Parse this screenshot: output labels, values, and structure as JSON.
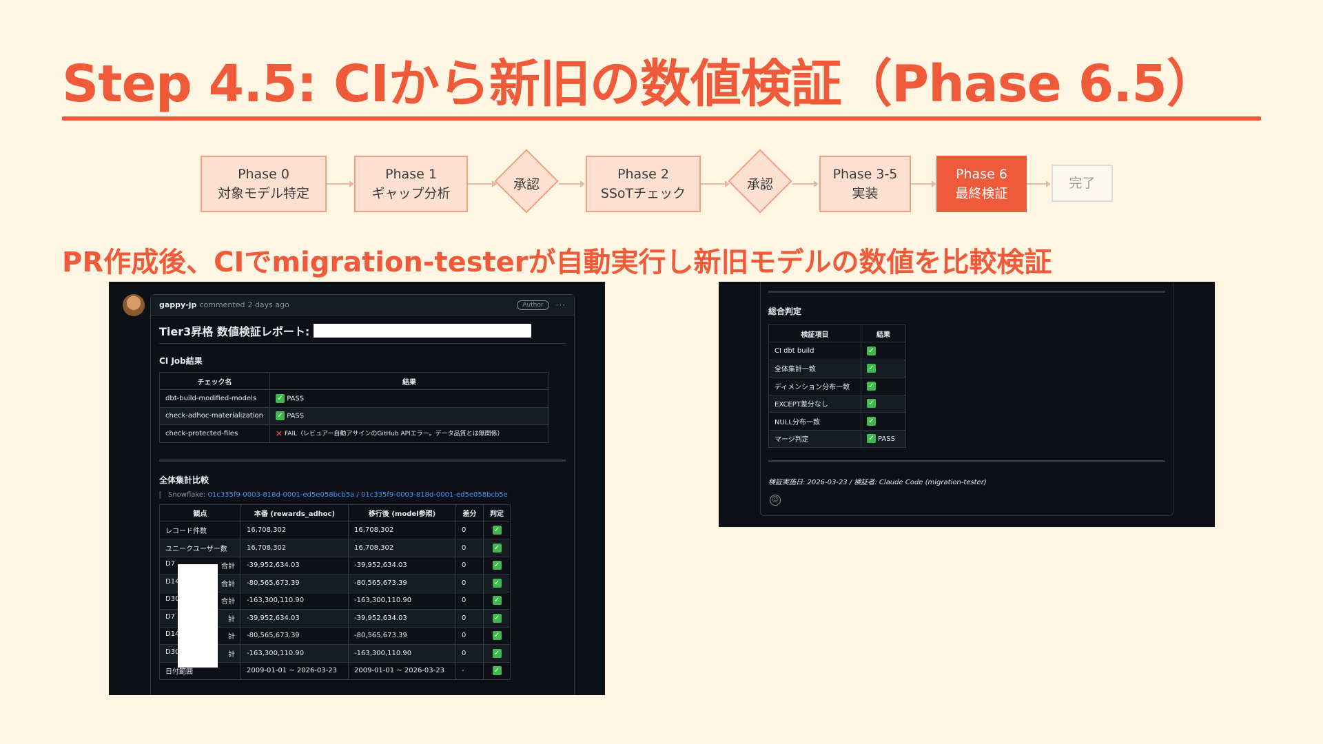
{
  "slide": {
    "title": "Step 4.5: CIから新旧の数値検証（Phase 6.5）",
    "subtitle": "PR作成後、CIでmigration-testerが自動実行し新旧モデルの数値を比較検証"
  },
  "flow": {
    "phase0": {
      "title": "Phase 0",
      "sub": "対象モデル特定"
    },
    "phase1": {
      "title": "Phase 1",
      "sub": "ギャップ分析"
    },
    "approve1": "承認",
    "phase2": {
      "title": "Phase 2",
      "sub": "SSoTチェック"
    },
    "approve2": "承認",
    "phase35": {
      "title": "Phase 3-5",
      "sub": "実装"
    },
    "phase6": {
      "title": "Phase 6",
      "sub": "最終検証"
    },
    "done": "完了"
  },
  "comment": {
    "user": "gappy-jp",
    "action": "commented",
    "time": "2 days ago",
    "badge": "Author",
    "more": "···",
    "report_title": "Tier3昇格 数値検証レポート:",
    "ci_heading": "CI Job結果",
    "ci_table": {
      "headers": [
        "チェック名",
        "結果"
      ],
      "rows": [
        {
          "name": "dbt-build-modified-models",
          "result": "PASS"
        },
        {
          "name": "check-adhoc-materialization",
          "result": "PASS"
        },
        {
          "name": "check-protected-files",
          "result": "FAIL（レビュアー自動アサインのGitHub APIエラー。データ品質とは無関係）"
        }
      ]
    },
    "agg_heading": "全体集計比較",
    "snowflake_label": "Snowflake:",
    "snowflake_link": "01c335f9-0003-818d-0001-ed5e058bcb5a / 01c335f9-0003-818d-0001-ed5e058bcb5e",
    "agg_table": {
      "headers": [
        "観点",
        "本番 (rewards_adhoc)",
        "移行後 (model参照)",
        "差分",
        "判定"
      ],
      "rows": [
        {
          "label": "レコード件数",
          "prod": "16,708,302",
          "after": "16,708,302",
          "diff": "0"
        },
        {
          "label": "ユニークユーザー数",
          "prod": "16,708,302",
          "after": "16,708,302",
          "diff": "0"
        },
        {
          "label": "D7",
          "tail": "合計",
          "prod": "-39,952,634.03",
          "after": "-39,952,634.03",
          "diff": "0"
        },
        {
          "label": "D14",
          "tail": "合計",
          "prod": "-80,565,673.39",
          "after": "-80,565,673.39",
          "diff": "0"
        },
        {
          "label": "D30",
          "tail": "合計",
          "prod": "-163,300,110.90",
          "after": "-163,300,110.90",
          "diff": "0"
        },
        {
          "label": "D7",
          "tail": "計",
          "prod": "-39,952,634.03",
          "after": "-39,952,634.03",
          "diff": "0"
        },
        {
          "label": "D14",
          "tail": "計",
          "prod": "-80,565,673.39",
          "after": "-80,565,673.39",
          "diff": "0"
        },
        {
          "label": "D30",
          "tail": "計",
          "prod": "-163,300,110.90",
          "after": "-163,300,110.90",
          "diff": "0"
        },
        {
          "label": "日付範囲",
          "prod": "2009-01-01 ~ 2026-03-23",
          "after": "2009-01-01 ~ 2026-03-23",
          "diff": "-"
        }
      ]
    }
  },
  "verdict": {
    "heading": "総合判定",
    "headers": [
      "検証項目",
      "結果"
    ],
    "rows": [
      {
        "item": "CI dbt build",
        "result": ""
      },
      {
        "item": "全体集計一致",
        "result": ""
      },
      {
        "item": "ディメンション分布一致",
        "result": ""
      },
      {
        "item": "EXCEPT差分なし",
        "result": ""
      },
      {
        "item": "NULL分布一致",
        "result": ""
      },
      {
        "item": "マージ判定",
        "result": "PASS"
      }
    ],
    "signature": "検証実施日: 2026-03-23 / 検証者: Claude Code (migration-tester)",
    "emoji": "☺"
  },
  "colors": {
    "accent": "#ee5a3a",
    "background": "#fef5e3",
    "pass": "#3fb950",
    "fail": "#f85149",
    "link": "#4493f8"
  },
  "icons": {
    "pass": "check-box-icon",
    "fail": "cross-icon"
  }
}
